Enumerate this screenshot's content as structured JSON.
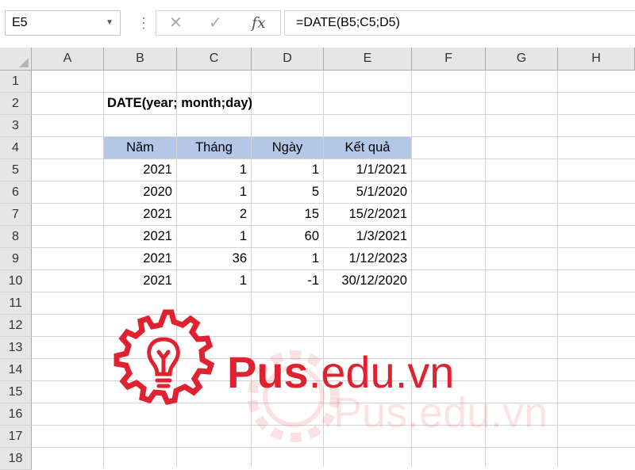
{
  "formula_bar": {
    "name_box": "E5",
    "formula": "=DATE(B5;C5;D5)",
    "fx_label": "fx",
    "cancel_glyph": "✕",
    "enter_glyph": "✓",
    "more_glyph": "⋮"
  },
  "columns": [
    "A",
    "B",
    "C",
    "D",
    "E",
    "F",
    "G",
    "H"
  ],
  "rows": [
    "1",
    "2",
    "3",
    "4",
    "5",
    "6",
    "7",
    "8",
    "9",
    "10",
    "11",
    "12",
    "13",
    "14",
    "15",
    "16",
    "17",
    "18"
  ],
  "sheet": {
    "title": "DATE(year; month;day)",
    "table_headers": [
      "Năm",
      "Tháng",
      "Ngày",
      "Kết quả"
    ],
    "table_rows": [
      [
        "2021",
        "1",
        "1",
        "1/1/2021"
      ],
      [
        "2020",
        "1",
        "5",
        "5/1/2020"
      ],
      [
        "2021",
        "2",
        "15",
        "15/2/2021"
      ],
      [
        "2021",
        "1",
        "60",
        "1/3/2021"
      ],
      [
        "2021",
        "36",
        "1",
        "1/12/2023"
      ],
      [
        "2021",
        "1",
        "-1",
        "30/12/2020"
      ]
    ]
  },
  "watermark": {
    "brand_bold": "Pus",
    "brand_rest": ".edu.vn",
    "ghost_text": "Pus.edu.vn",
    "icon": "lightbulb-gear-icon",
    "color": "#e02230"
  },
  "colors": {
    "header_fill": "#b4c7e7",
    "grid_line": "#d4d4d4",
    "header_bg": "#e6e6e6"
  }
}
